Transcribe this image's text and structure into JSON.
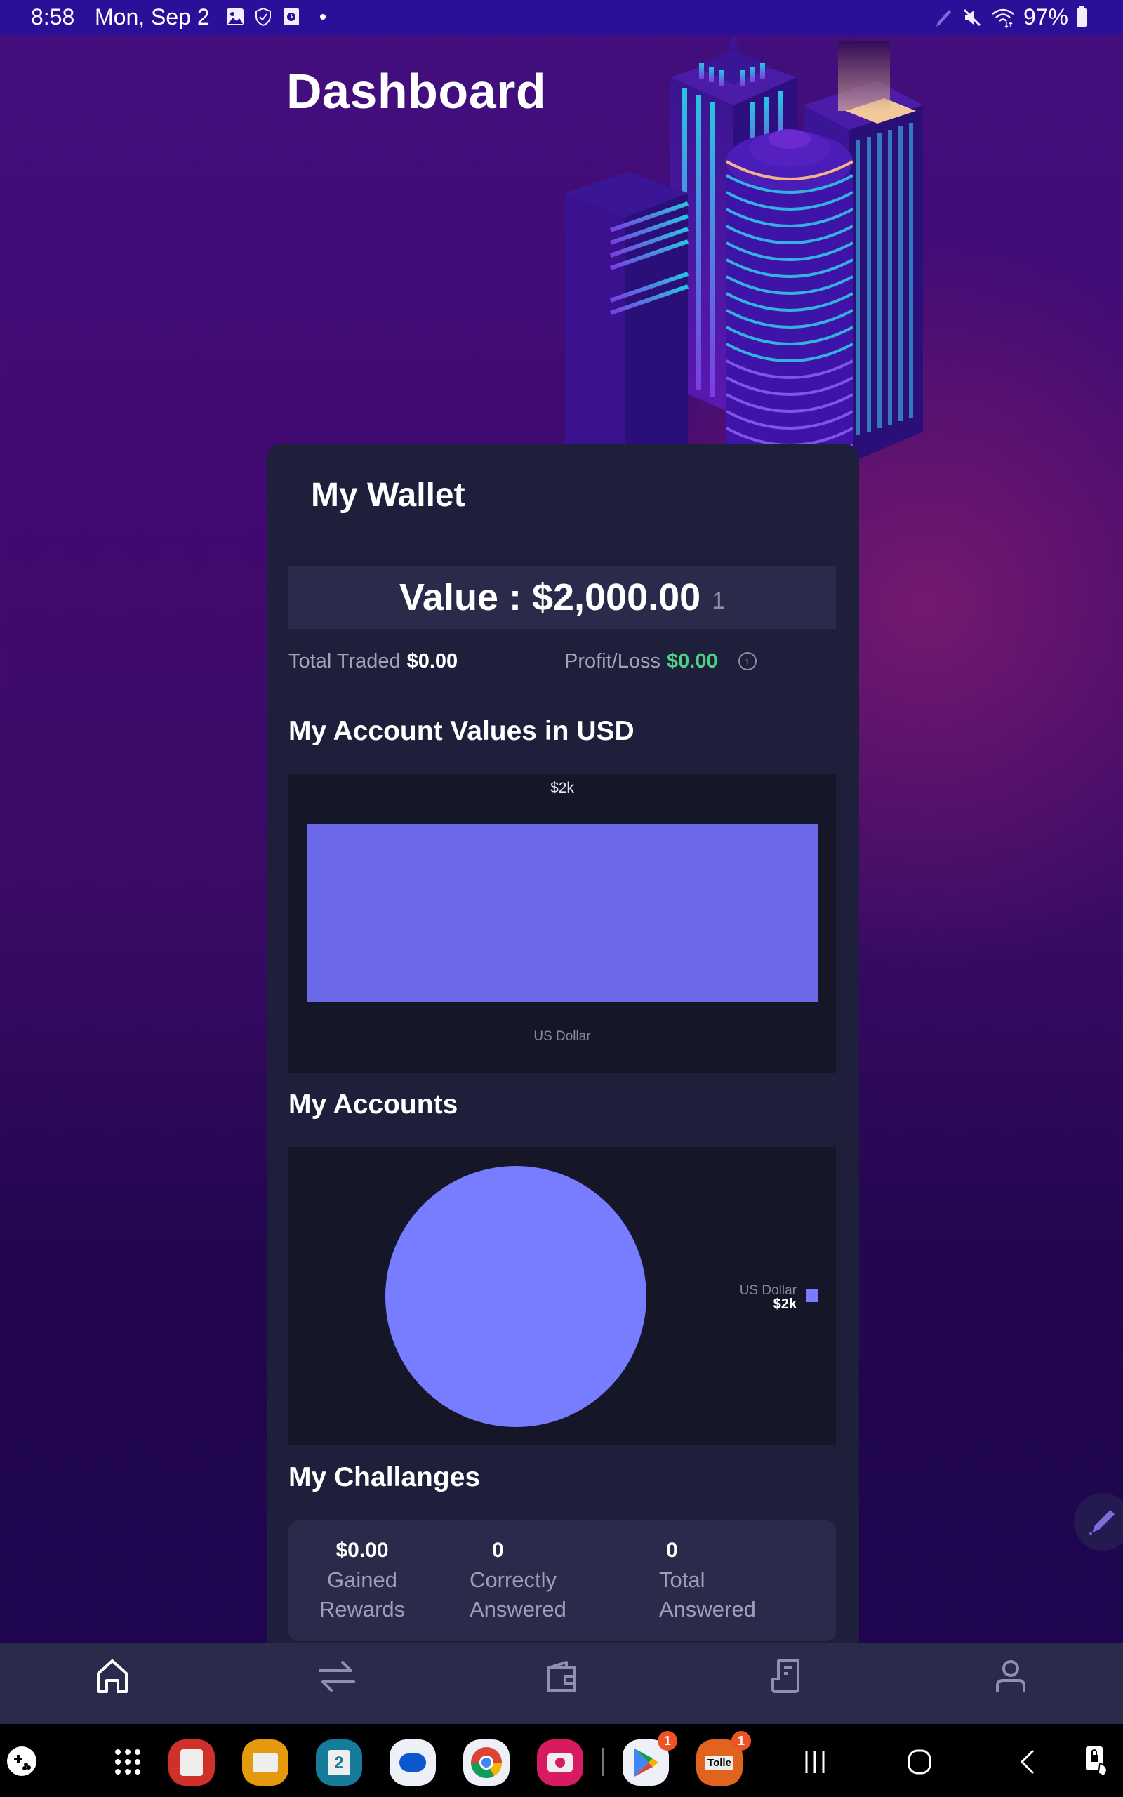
{
  "status_bar": {
    "time": "8:58",
    "date": "Mon, Sep 2",
    "left_icons": [
      "gallery-icon",
      "shield-check-icon",
      "clock-app-icon",
      "dot-icon"
    ],
    "right_icons": [
      "pen-icon",
      "mute-icon",
      "wifi-icon"
    ],
    "battery": "97%"
  },
  "header": {
    "title": "Dashboard"
  },
  "wallet": {
    "title": "My Wallet",
    "value_label": "Value : $2,000.00",
    "value_suffix": "1",
    "total_traded_label": "Total Traded",
    "total_traded_value": "$0.00",
    "profit_loss_label": "Profit/Loss",
    "profit_loss_value": "$0.00"
  },
  "account_values": {
    "title": "My Account Values in USD"
  },
  "accounts": {
    "title": "My Accounts"
  },
  "challenges": {
    "title": "My Challanges",
    "stats": [
      {
        "value": "$0.00",
        "label_line1": "Gained",
        "label_line2": "Rewards"
      },
      {
        "value": "0",
        "label_line1": "Correctly",
        "label_line2": "Answered"
      },
      {
        "value": "0",
        "label_line1": "Total",
        "label_line2": "Answered"
      }
    ]
  },
  "colors": {
    "accent_bar": "#6b69e8",
    "accent_pie": "#787cfe",
    "profit_green": "#4fcf87",
    "card_bg": "#1d1f3b",
    "panel_bg": "#151729"
  },
  "chart_data": [
    {
      "type": "bar",
      "title": "My Account Values in USD",
      "categories": [
        "US Dollar"
      ],
      "values": [
        2000
      ],
      "data_labels": [
        "$2k"
      ],
      "xlabel": "",
      "ylabel": "",
      "ylim": [
        0,
        2000
      ],
      "grid": false
    },
    {
      "type": "pie",
      "title": "My Accounts",
      "labels": [
        "US Dollar"
      ],
      "values": [
        2000
      ],
      "value_labels": [
        "$2k"
      ],
      "legend": "right"
    }
  ],
  "bottom_nav": {
    "items": [
      {
        "name": "home",
        "icon": "home-icon",
        "active": true
      },
      {
        "name": "trade",
        "icon": "swap-arrows-icon",
        "active": false
      },
      {
        "name": "wallet",
        "icon": "wallet-icon",
        "active": false
      },
      {
        "name": "history",
        "icon": "receipt-icon",
        "active": false
      },
      {
        "name": "profile",
        "icon": "user-icon",
        "active": false
      }
    ]
  },
  "system_nav": {
    "apps": [
      {
        "name": "Notes",
        "badge": ""
      },
      {
        "name": "Files",
        "badge": ""
      },
      {
        "name": "Calendar",
        "calendar_day": "2",
        "badge": ""
      },
      {
        "name": "Messages",
        "badge": ""
      },
      {
        "name": "Chrome",
        "badge": ""
      },
      {
        "name": "Camera",
        "badge": ""
      },
      {
        "name": "Play Store",
        "badge": "1"
      },
      {
        "name": "Tolle",
        "label": "Tolle",
        "badge": "1"
      }
    ]
  }
}
